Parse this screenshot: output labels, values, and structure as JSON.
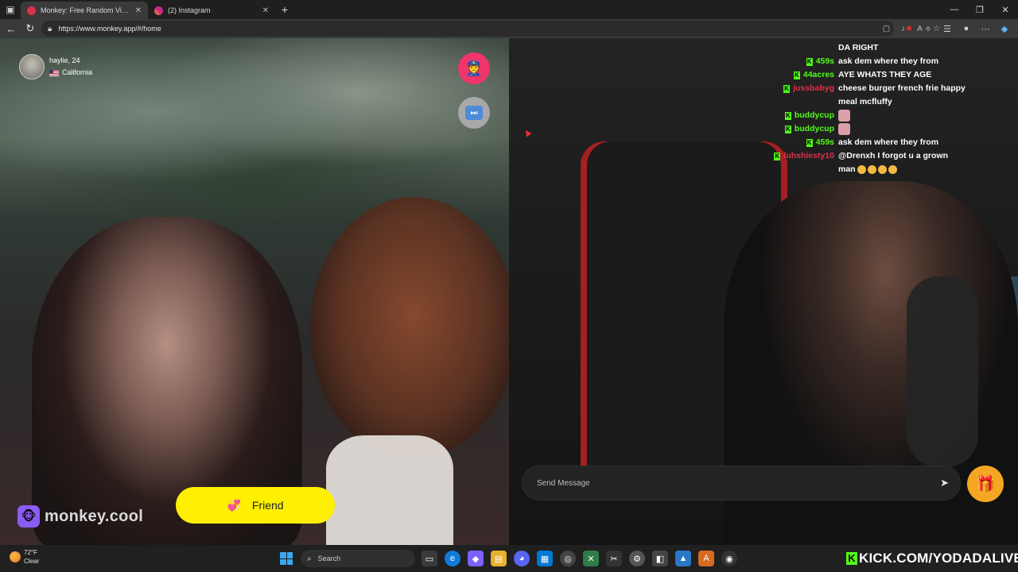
{
  "browser": {
    "tabs": [
      {
        "title": "Monkey: Free Random Video",
        "active": true
      },
      {
        "title": "(2) Instagram",
        "active": false
      }
    ],
    "url": "https://www.monkey.app/#/home"
  },
  "stranger": {
    "name_age": "haylie, 24",
    "location": "California"
  },
  "watermark": "monkey.cool",
  "friend_button": "Friend",
  "chat": {
    "messages": [
      {
        "user": "",
        "text": "DA RIGHT",
        "user_color": "#ffffff"
      },
      {
        "user": "459s",
        "text": "ask dem where they from",
        "user_color": "#53fc18"
      },
      {
        "user": "44acres",
        "text": "AYE WHATS THEY AGE",
        "user_color": "#53fc18"
      },
      {
        "user": "jussbabyg",
        "text": "cheese burger french frie happy meal mcfluffy",
        "user_color": "#e0304a"
      },
      {
        "user": "buddycup",
        "text": "",
        "user_color": "#53fc18",
        "emote": true
      },
      {
        "user": "buddycup",
        "text": "",
        "user_color": "#53fc18",
        "emote": true
      },
      {
        "user": "459s",
        "text": "ask dem where they from",
        "user_color": "#53fc18"
      },
      {
        "user": "luhshiesty10",
        "text": "@Drenxh I forgot u a grown man",
        "user_color": "#e0304a",
        "emojis": 4
      }
    ],
    "input_placeholder": "Send Message"
  },
  "taskbar": {
    "temperature": "72°F",
    "condition": "Clear",
    "search_label": "Search"
  },
  "stream_banner": "KICK.COM/YODADALIVE",
  "colors": {
    "friend_yellow": "#ffef00",
    "report_pink": "#f0356b",
    "gift_orange": "#f5a623",
    "kick_green": "#53fc18"
  }
}
